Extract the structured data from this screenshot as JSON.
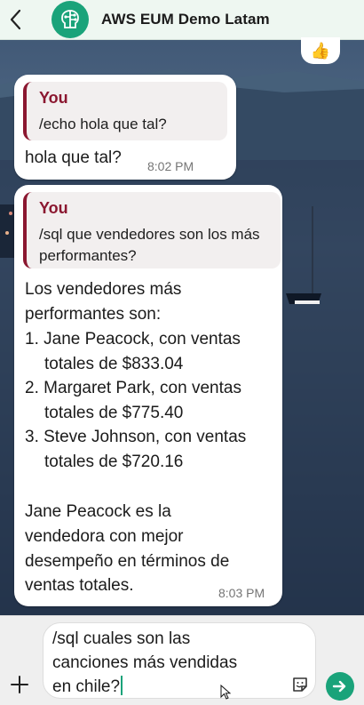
{
  "header": {
    "back_icon": "chevron-left-icon",
    "avatar_icon": "brain-circuit-icon",
    "title": "AWS EUM Demo Latam"
  },
  "reaction": {
    "emoji": "👍"
  },
  "messages": [
    {
      "quote_author": "You",
      "quote_text": "/echo hola que tal?",
      "text": "hola que tal?",
      "time": "8:02 PM"
    },
    {
      "quote_author": "You",
      "quote_lines": [
        "/sql que vendedores son los más",
        "performantes?"
      ],
      "intro_lines": [
        "Los vendedores más",
        "performantes son:"
      ],
      "list": [
        [
          "1. Jane Peacock, con ventas",
          "totales de $833.04"
        ],
        [
          "2. Margaret Park, con ventas",
          "totales de $775.40"
        ],
        [
          "3. Steve Johnson, con ventas",
          "totales de $720.16"
        ]
      ],
      "summary_lines": [
        "Jane Peacock es la",
        "vendedora con mejor",
        "desempeño en términos de",
        "ventas totales."
      ],
      "time": "8:03 PM"
    }
  ],
  "composer": {
    "add_icon": "plus-icon",
    "input_lines": [
      "/sql cuales son las",
      "canciones más vendidas",
      "en chile?"
    ],
    "sticker_icon": "sticker-icon",
    "send_icon": "send-icon"
  },
  "colors": {
    "accent": "#1aa37a",
    "quote_bar": "#8b1730",
    "header_bg": "#eef7f1"
  }
}
